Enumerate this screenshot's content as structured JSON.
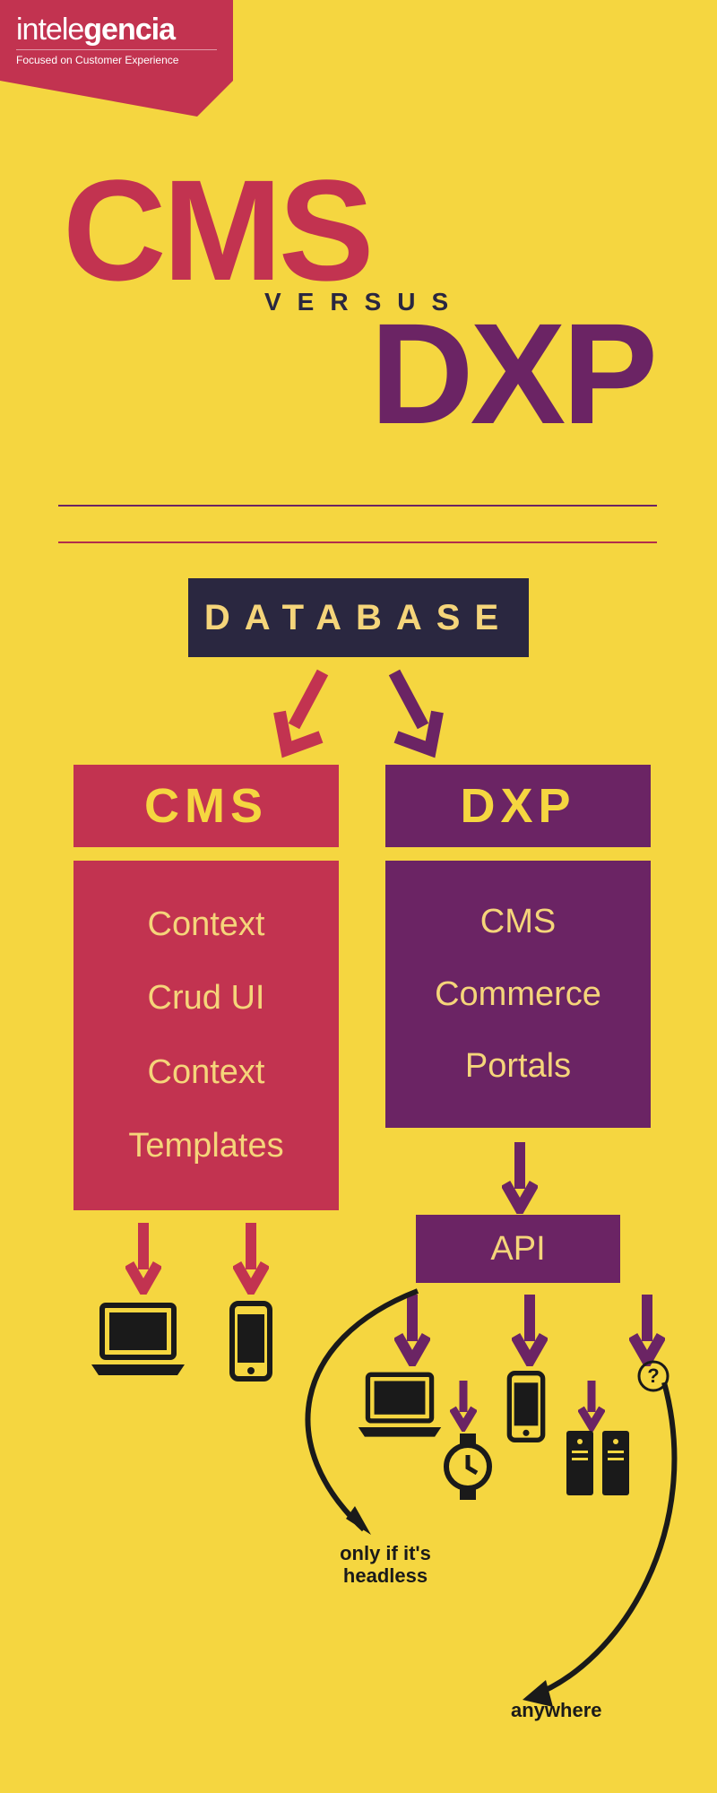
{
  "brand": {
    "name_prefix": "intele",
    "name_bold": "gencia",
    "tagline": "Focused on Customer Experience"
  },
  "title": {
    "cms": "CMS",
    "versus": "VERSUS",
    "dxp": "DXP"
  },
  "database_label": "DATABASE",
  "cms": {
    "header": "CMS",
    "items": [
      "Context",
      "Crud UI",
      "Context",
      "Templates"
    ]
  },
  "dxp": {
    "header": "DXP",
    "items": [
      "CMS",
      "Commerce",
      "Portals"
    ],
    "api": "API"
  },
  "notes": {
    "headless": "only if it's headless",
    "anywhere": "anywhere"
  }
}
